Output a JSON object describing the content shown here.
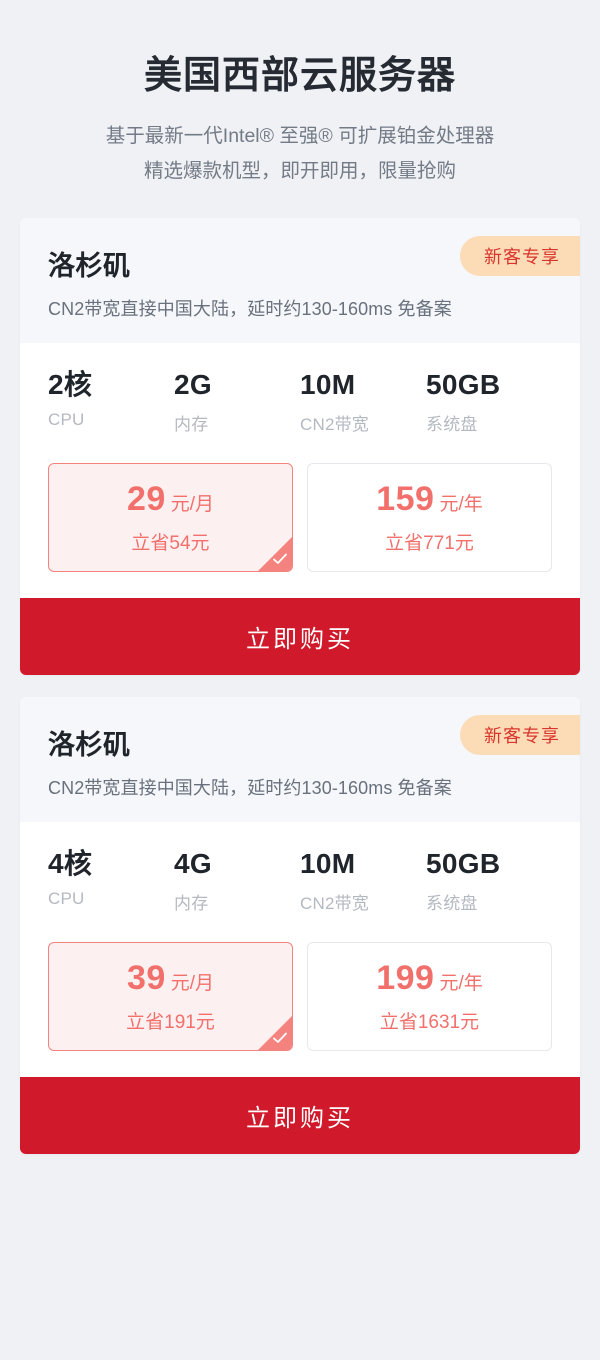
{
  "hero": {
    "title": "美国西部云服务器",
    "sub_line1": "基于最新一代Intel® 至强® 可扩展铂金处理器",
    "sub_line2": "精选爆款机型，即开即用，限量抢购"
  },
  "cards": [
    {
      "region": "洛杉矶",
      "desc": "CN2带宽直接中国大陆，延时约130-160ms 免备案",
      "badge": "新客专享",
      "specs": [
        {
          "value": "2核",
          "label": "CPU"
        },
        {
          "value": "2G",
          "label": "内存"
        },
        {
          "value": "10M",
          "label": "CN2带宽"
        },
        {
          "value": "50GB",
          "label": "系统盘"
        }
      ],
      "prices": [
        {
          "amount": "29",
          "unit": "元/月",
          "save": "立省54元",
          "selected": true
        },
        {
          "amount": "159",
          "unit": "元/年",
          "save": "立省771元",
          "selected": false
        }
      ],
      "buy_label": "立即购买"
    },
    {
      "region": "洛杉矶",
      "desc": "CN2带宽直接中国大陆，延时约130-160ms 免备案",
      "badge": "新客专享",
      "specs": [
        {
          "value": "4核",
          "label": "CPU"
        },
        {
          "value": "4G",
          "label": "内存"
        },
        {
          "value": "10M",
          "label": "CN2带宽"
        },
        {
          "value": "50GB",
          "label": "系统盘"
        }
      ],
      "prices": [
        {
          "amount": "39",
          "unit": "元/月",
          "save": "立省191元",
          "selected": true
        },
        {
          "amount": "199",
          "unit": "元/年",
          "save": "立省1631元",
          "selected": false
        }
      ],
      "buy_label": "立即购买"
    }
  ],
  "colors": {
    "page_bg": "#eff1f4",
    "card_head_bg": "#f5f7fa",
    "badge_bg": "#fbdcb7",
    "badge_text": "#d9352c",
    "price_red": "#f2706c",
    "selected_border": "#f4837f",
    "selected_bg": "#fdf0f0",
    "buy_red": "#d0192a"
  },
  "icons": {
    "check": "check-icon"
  }
}
